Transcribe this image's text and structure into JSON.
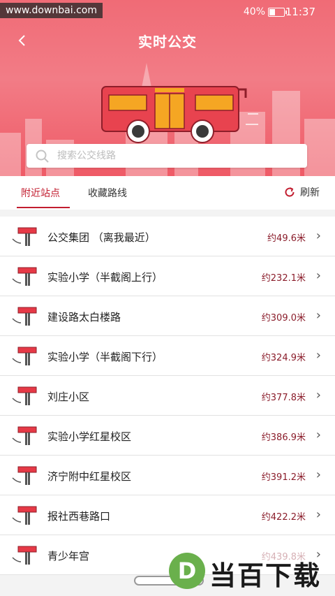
{
  "status_bar": {
    "watermark": "www.downbai.com",
    "battery": "40%",
    "time": "11:37"
  },
  "header": {
    "title": "实时公交",
    "back_icon": "chevron-left-icon"
  },
  "search": {
    "placeholder": "搜索公交线路",
    "icon": "search-icon"
  },
  "tabs": [
    {
      "label": "附近站点",
      "active": true
    },
    {
      "label": "收藏路线",
      "active": false
    }
  ],
  "refresh_label": "刷新",
  "stops": [
    {
      "name": "公交集团  （离我最近）",
      "distance": "约49.6米"
    },
    {
      "name": "实验小学（半截阁上行）",
      "distance": "约232.1米"
    },
    {
      "name": "建设路太白楼路",
      "distance": "约309.0米"
    },
    {
      "name": "实验小学（半截阁下行）",
      "distance": "约324.9米"
    },
    {
      "name": "刘庄小区",
      "distance": "约377.8米"
    },
    {
      "name": "实验小学红星校区",
      "distance": "约386.9米"
    },
    {
      "name": "济宁附中红星校区",
      "distance": "约391.2米"
    },
    {
      "name": "报社西巷路口",
      "distance": "约422.2米"
    },
    {
      "name": "青少年宫",
      "distance": "约439.8米"
    }
  ],
  "brand": {
    "text": "当百下载",
    "logo_letter": "D"
  },
  "colors": {
    "header": "#f06b76",
    "accent": "#c21d2f",
    "distance": "#8a1c2a"
  }
}
